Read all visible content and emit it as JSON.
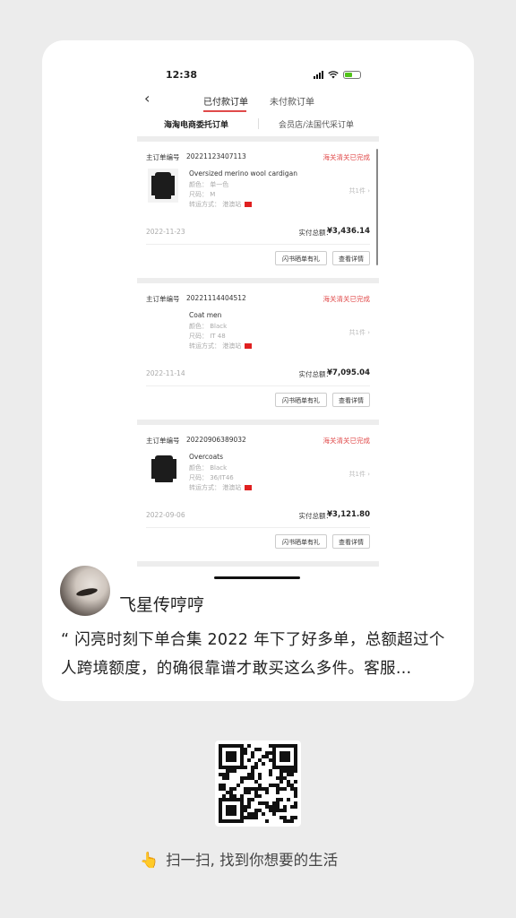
{
  "status_bar": {
    "time": "12:38"
  },
  "nav": {
    "back": "‹",
    "tab_paid": "已付款订单",
    "tab_unpaid": "未付款订单"
  },
  "subtabs": {
    "a": "海淘电商委托订单",
    "b": "会员店/法国代采订单"
  },
  "orders": [
    {
      "no_label": "主订单编号",
      "no": "20221123407113",
      "status": "海关清关已完成",
      "product": "Oversized merino wool cardigan",
      "attrs": [
        "颜色： 单一色",
        "尺码： M",
        "转运方式： 港澳站"
      ],
      "qty": "共1件 ›",
      "date": "2022-11-23",
      "total_label": "实付总额：",
      "total": "¥3,436.14",
      "btn_share": "闪书晒单有礼",
      "btn_detail": "查看详情"
    },
    {
      "no_label": "主订单编号",
      "no": "20221114404512",
      "status": "海关清关已完成",
      "product": "Coat men",
      "attrs": [
        "颜色： Black",
        "尺码： IT 48",
        "转运方式： 港澳站"
      ],
      "qty": "共1件 ›",
      "date": "2022-11-14",
      "total_label": "实付总额：",
      "total": "¥7,095.04",
      "btn_share": "闪书晒单有礼",
      "btn_detail": "查看详情"
    },
    {
      "no_label": "主订单编号",
      "no": "20220906389032",
      "status": "海关清关已完成",
      "product": "Overcoats",
      "attrs": [
        "颜色： Black",
        "尺码： 36/IT46",
        "转运方式： 港澳站"
      ],
      "qty": "共1件 ›",
      "date": "2022-09-06",
      "total_label": "实付总额：",
      "total": "¥3,121.80",
      "btn_share": "闪书晒单有礼",
      "btn_detail": "查看详情"
    }
  ],
  "user": {
    "name": "飞星传哼哼"
  },
  "quote": "“ 闪亮时刻下单合集 2022 年下了好多单，总额超过个人跨境额度，的确很靠谱才敢买这么多件。客服…",
  "footer": {
    "hand_icon": "👆",
    "slogan": "扫一扫, 找到你想要的生活"
  }
}
